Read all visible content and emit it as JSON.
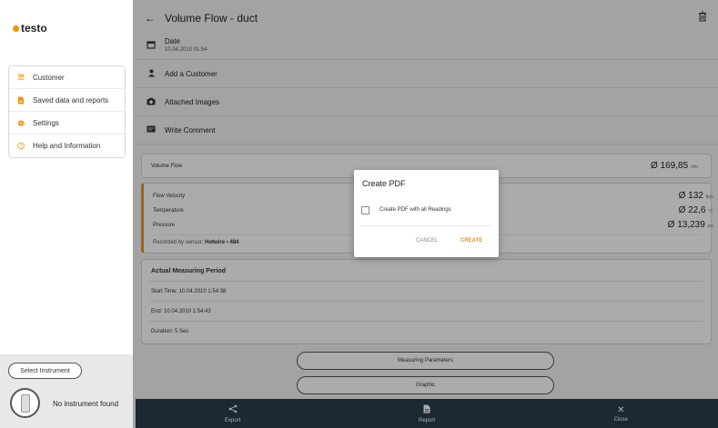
{
  "brand": {
    "logo_text": "testo",
    "accent": "#f39200"
  },
  "sidebar": {
    "items": [
      {
        "label": "Customer",
        "icon": "customer-icon"
      },
      {
        "label": "Saved data and reports",
        "icon": "document-icon"
      },
      {
        "label": "Settings",
        "icon": "gear-icon"
      },
      {
        "label": "Help and Information",
        "icon": "help-icon"
      }
    ],
    "select_instrument": "Select Instrument",
    "no_instrument": "No instrument found"
  },
  "header": {
    "title": "Volume Flow - duct"
  },
  "info_rows": {
    "date_label": "Date",
    "date_value": "10.04.2010 01:54",
    "add_customer": "Add a Customer",
    "attached_images": "Attached Images",
    "write_comment": "Write Comment"
  },
  "volume_flow": {
    "label": "Volume Flow",
    "value": "Ø 169,85",
    "unit": "cfm"
  },
  "readings": [
    {
      "label": "Flow Velocity",
      "value": "Ø 132",
      "unit": "fpm"
    },
    {
      "label": "Temperature",
      "value": "Ø 22,6",
      "unit": "°C"
    },
    {
      "label": "Pressure",
      "value": "Ø 13,239",
      "unit": "psi"
    }
  ],
  "recorded": {
    "prefix": "Recorded by sensor:",
    "sensor": "Hotwire • 484"
  },
  "period": {
    "title": "Actual Measuring Period",
    "start": "Start Time: 10.04.2010 1:54:38",
    "end": "End: 10.04.2010 1:54:43",
    "duration": "Duration: 5 Sec"
  },
  "buttons": {
    "measuring_parameters": "Measuring Parameters",
    "graphic": "Graphic"
  },
  "bottom_bar": {
    "export": "Export",
    "report": "Report",
    "close": "Close"
  },
  "dialog": {
    "title": "Create PDF",
    "checkbox_label": "Create PDF with all Readings",
    "cancel": "CANCEL",
    "create": "CREATE"
  }
}
